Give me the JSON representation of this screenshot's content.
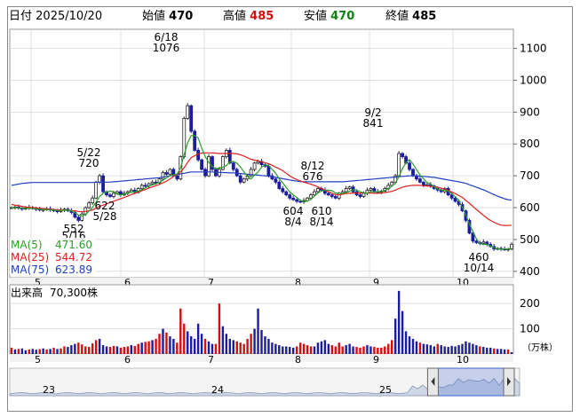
{
  "header": {
    "date_label": "日付",
    "date": "2025/10/20",
    "open_label": "始値",
    "open": "470",
    "high_label": "高値",
    "high": "485",
    "low_label": "安値",
    "low": "470",
    "close_label": "終値",
    "close": "485"
  },
  "colors": {
    "up": "#222222",
    "down": "#1c1c9e",
    "ma5": "#2aa02a",
    "ma25": "#e02020",
    "ma75": "#2040c0",
    "high_text": "#d01010",
    "low_text": "#108010",
    "grid": "#cccccc",
    "volume_up": "#d01010",
    "volume_down": "#1c1c9e"
  },
  "chart_data": [
    {
      "type": "candlestick",
      "x_months": [
        "5",
        "6",
        "7",
        "8",
        "9",
        "10"
      ],
      "y_ticks": [
        400,
        500,
        600,
        700,
        800,
        900,
        1000,
        1100
      ],
      "ylim": [
        380,
        1160
      ],
      "legend": [
        {
          "name": "MA(5)",
          "value": "471.60",
          "color": "#2aa02a"
        },
        {
          "name": "MA(25)",
          "value": "544.72",
          "color": "#e02020"
        },
        {
          "name": "MA(75)",
          "value": "623.89",
          "color": "#2040c0"
        }
      ],
      "annotations": [
        {
          "date": "5/16",
          "value": "552"
        },
        {
          "date": "5/22",
          "value": "720"
        },
        {
          "date": "5/28",
          "value": "622"
        },
        {
          "date": "6/18",
          "value": "1076"
        },
        {
          "date": "8/4",
          "value": "604"
        },
        {
          "date": "8/12",
          "value": "676"
        },
        {
          "date": "8/14",
          "value": "610"
        },
        {
          "date": "9/2",
          "value": "841"
        },
        {
          "date": "10/14",
          "value": "460"
        }
      ],
      "close_series": [
        600,
        602,
        598,
        596,
        599,
        601,
        597,
        595,
        592,
        594,
        596,
        593,
        590,
        588,
        592,
        595,
        590,
        585,
        570,
        560,
        580,
        600,
        615,
        630,
        680,
        700,
        650,
        640,
        635,
        645,
        650,
        640,
        645,
        650,
        655,
        648,
        660,
        670,
        668,
        675,
        680,
        678,
        690,
        710,
        705,
        720,
        700,
        690,
        760,
        880,
        920,
        840,
        780,
        750,
        720,
        700,
        760,
        720,
        700,
        720,
        760,
        780,
        740,
        720,
        700,
        680,
        690,
        700,
        720,
        740,
        745,
        735,
        730,
        700,
        690,
        680,
        660,
        650,
        640,
        630,
        625,
        620,
        618,
        622,
        630,
        640,
        650,
        660,
        655,
        645,
        640,
        635,
        630,
        645,
        650,
        660,
        665,
        650,
        640,
        635,
        645,
        655,
        660,
        650,
        648,
        652,
        660,
        670,
        680,
        700,
        770,
        760,
        740,
        720,
        700,
        690,
        680,
        670,
        672,
        668,
        660,
        655,
        650,
        660,
        640,
        630,
        620,
        610,
        590,
        560,
        520,
        495,
        490,
        488,
        492,
        485,
        478,
        470,
        472,
        470,
        468,
        470,
        485
      ],
      "ma5": [
        600,
        600,
        599,
        598,
        598,
        598,
        597,
        596,
        595,
        594,
        594,
        593,
        592,
        591,
        591,
        592,
        592,
        590,
        584,
        577,
        574,
        579,
        589,
        601,
        617,
        635,
        645,
        649,
        652,
        650,
        642,
        640,
        642,
        646,
        649,
        650,
        652,
        656,
        662,
        668,
        671,
        675,
        679,
        687,
        693,
        700,
        703,
        705,
        724,
        766,
        803,
        826,
        826,
        819,
        787,
        760,
        742,
        730,
        722,
        724,
        727,
        732,
        744,
        745,
        740,
        728,
        712,
        698,
        690,
        702,
        712,
        727,
        734,
        732,
        720,
        708,
        691,
        678,
        663,
        650,
        640,
        632,
        623,
        619,
        621,
        626,
        636,
        646,
        652,
        655,
        655,
        653,
        646,
        645,
        645,
        647,
        652,
        656,
        655,
        650,
        647,
        645,
        650,
        650,
        650,
        650,
        654,
        660,
        667,
        678,
        697,
        723,
        742,
        751,
        737,
        719,
        703,
        690,
        679,
        674,
        666,
        658,
        655,
        655,
        652,
        644,
        635,
        622,
        602,
        577,
        549,
        525,
        502,
        487,
        484,
        485,
        480,
        474,
        471,
        469,
        470,
        470,
        472
      ],
      "ma25": [
        610,
        608,
        606,
        604,
        602,
        601,
        600,
        599,
        598,
        597,
        596,
        595,
        594,
        593,
        593,
        592,
        592,
        591,
        590,
        588,
        587,
        588,
        590,
        593,
        598,
        604,
        608,
        612,
        616,
        620,
        624,
        628,
        632,
        636,
        641,
        645,
        649,
        653,
        657,
        661,
        665,
        669,
        673,
        678,
        683,
        690,
        698,
        705,
        712,
        725,
        742,
        757,
        763,
        768,
        771,
        772,
        772,
        772,
        771,
        770,
        770,
        770,
        770,
        770,
        769,
        766,
        762,
        757,
        752,
        749,
        747,
        744,
        741,
        738,
        733,
        727,
        722,
        716,
        708,
        700,
        693,
        688,
        684,
        680,
        677,
        674,
        670,
        665,
        660,
        655,
        650,
        645,
        641,
        640,
        642,
        644,
        645,
        646,
        646,
        646,
        646,
        646,
        646,
        645,
        645,
        646,
        647,
        649,
        651,
        655,
        660,
        664,
        667,
        669,
        670,
        670,
        670,
        669,
        668,
        667,
        666,
        664,
        661,
        658,
        654,
        649,
        644,
        638,
        632,
        623,
        614,
        604,
        594,
        585,
        576,
        567,
        560,
        554,
        549,
        545,
        544,
        544,
        545
      ],
      "ma75": [
        670,
        672,
        674,
        676,
        677,
        678,
        679,
        679,
        679,
        679,
        679,
        679,
        679,
        679,
        679,
        679,
        679,
        679,
        679,
        679,
        679,
        679,
        679,
        679,
        680,
        680,
        680,
        680,
        680,
        681,
        682,
        683,
        684,
        685,
        686,
        687,
        688,
        689,
        690,
        691,
        692,
        693,
        694,
        696,
        698,
        700,
        702,
        704,
        706,
        708,
        710,
        712,
        712,
        712,
        712,
        712,
        712,
        712,
        711,
        711,
        710,
        710,
        709,
        709,
        708,
        707,
        706,
        705,
        704,
        703,
        702,
        701,
        700,
        699,
        697,
        695,
        693,
        691,
        689,
        687,
        685,
        683,
        682,
        681,
        681,
        681,
        681,
        681,
        681,
        681,
        681,
        681,
        681,
        681,
        681,
        682,
        683,
        684,
        685,
        686,
        687,
        688,
        689,
        690,
        691,
        692,
        693,
        694,
        695,
        696,
        697,
        698,
        699,
        700,
        700,
        700,
        699,
        698,
        697,
        696,
        695,
        693,
        691,
        689,
        687,
        685,
        683,
        681,
        679,
        676,
        672,
        668,
        664,
        660,
        656,
        651,
        646,
        641,
        636,
        632,
        628,
        625,
        624
      ]
    },
    {
      "type": "bar",
      "title": "出来高",
      "latest_volume": "70,300株",
      "y_ticks": [
        100,
        200
      ],
      "unit": "（万株）",
      "x_months": [
        "5",
        "6",
        "7",
        "8",
        "9",
        "10"
      ],
      "values": [
        25,
        18,
        20,
        22,
        15,
        18,
        20,
        17,
        19,
        22,
        18,
        20,
        25,
        20,
        22,
        30,
        28,
        35,
        40,
        45,
        38,
        30,
        28,
        42,
        55,
        60,
        35,
        30,
        28,
        32,
        30,
        25,
        28,
        30,
        35,
        32,
        40,
        45,
        48,
        50,
        55,
        60,
        80,
        100,
        85,
        70,
        60,
        45,
        180,
        120,
        90,
        70,
        60,
        120,
        80,
        60,
        50,
        40,
        40,
        200,
        110,
        80,
        60,
        55,
        50,
        45,
        40,
        60,
        80,
        100,
        180,
        95,
        70,
        60,
        45,
        40,
        35,
        30,
        30,
        28,
        25,
        30,
        45,
        40,
        35,
        30,
        30,
        45,
        50,
        55,
        40,
        35,
        30,
        45,
        30,
        35,
        40,
        30,
        28,
        25,
        30,
        35,
        30,
        28,
        25,
        25,
        30,
        40,
        55,
        140,
        250,
        170,
        90,
        70,
        60,
        50,
        45,
        40,
        38,
        35,
        30,
        40,
        35,
        30,
        28,
        32,
        30,
        35,
        40,
        50,
        45,
        40,
        35,
        30,
        28,
        25,
        25,
        22,
        20,
        20,
        18,
        18,
        7
      ],
      "up_flags": [
        1,
        0,
        1,
        0,
        0,
        1,
        0,
        0,
        1,
        0,
        1,
        0,
        1,
        0,
        1,
        1,
        0,
        0,
        0,
        1,
        1,
        1,
        1,
        1,
        1,
        0,
        0,
        0,
        1,
        1,
        0,
        1,
        1,
        1,
        0,
        1,
        1,
        0,
        1,
        1,
        0,
        1,
        1,
        0,
        1,
        0,
        0,
        1,
        1,
        1,
        0,
        0,
        0,
        0,
        0,
        1,
        0,
        0,
        1,
        1,
        0,
        0,
        0,
        0,
        1,
        1,
        1,
        1,
        1,
        0,
        0,
        0,
        0,
        0,
        0,
        0,
        0,
        0,
        0,
        0,
        0,
        1,
        1,
        1,
        1,
        1,
        0,
        0,
        0,
        0,
        0,
        1,
        1,
        1,
        1,
        0,
        0,
        0,
        1,
        1,
        1,
        0,
        0,
        1,
        1,
        1,
        1,
        1,
        1,
        0,
        0,
        0,
        0,
        0,
        0,
        0,
        1,
        0,
        0,
        0,
        0,
        1,
        0,
        0,
        0,
        0,
        0,
        0,
        0,
        0,
        0,
        0,
        0,
        1,
        0,
        0,
        0,
        1,
        0,
        0,
        0,
        1
      ]
    },
    {
      "type": "area",
      "title": "navigator",
      "year_labels": [
        "23",
        "24",
        "25"
      ],
      "range_start_fraction": 0.83,
      "range_end_fraction": 1.0
    }
  ]
}
